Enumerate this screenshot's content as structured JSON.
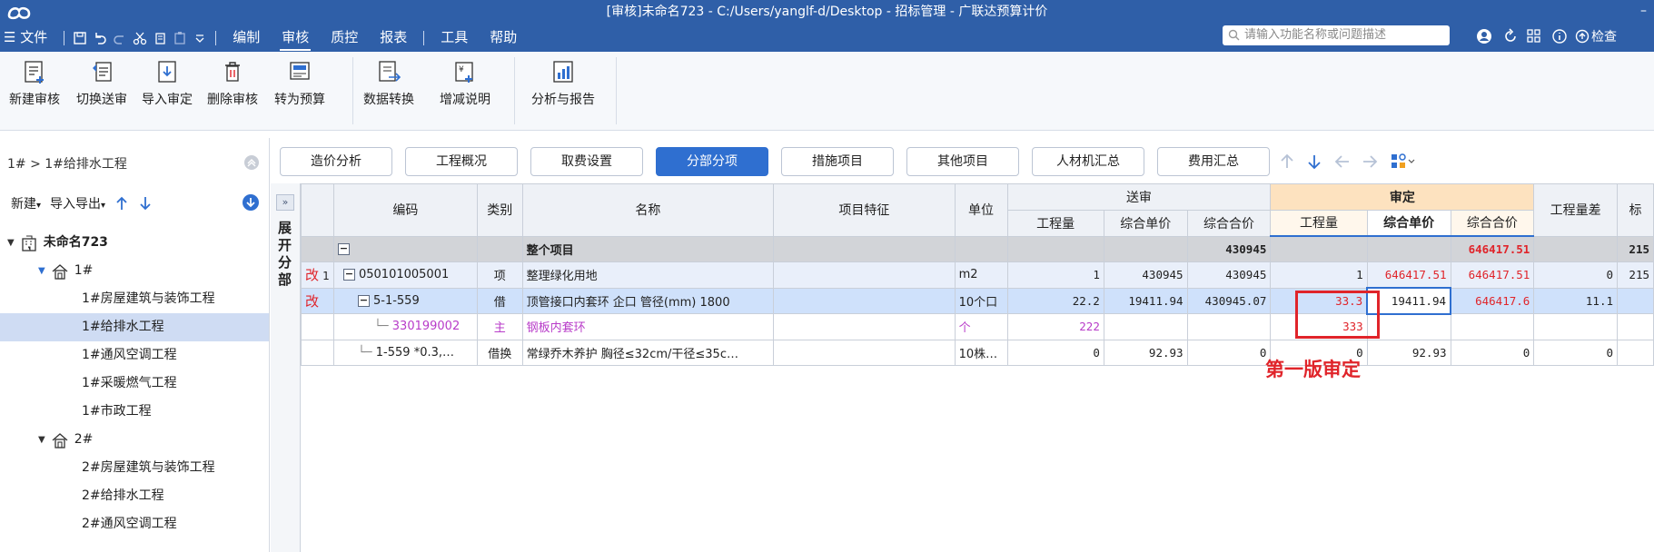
{
  "window": {
    "title": "[审核]未命名723 - C:/Users/yanglf-d/Desktop - 招标管理 - 广联达预算计价",
    "minimize_label": "–"
  },
  "menu": {
    "file": "☰ 文件",
    "items": [
      "编制",
      "审核",
      "质控",
      "报表",
      "工具",
      "帮助"
    ]
  },
  "search": {
    "placeholder": "请输入功能名称或问题描述"
  },
  "right_tools": {
    "check_label": "检查"
  },
  "ribbon": {
    "buttons": [
      "新建审核",
      "切换送审",
      "导入审定",
      "删除审核",
      "转为预算",
      "数据转换",
      "增减说明",
      "分析与报告"
    ]
  },
  "left": {
    "breadcrumb": "1# > 1#给排水工程",
    "toolbar": {
      "new_label": "新建",
      "import_export_label": "导入导出"
    },
    "tree": {
      "root": "未命名723",
      "group1": "1#",
      "g1_items": [
        "1#房屋建筑与装饰工程",
        "1#给排水工程",
        "1#通风空调工程",
        "1#采暖燃气工程",
        "1#市政工程"
      ],
      "group2": "2#",
      "g2_items": [
        "2#房屋建筑与装饰工程",
        "2#给排水工程",
        "2#通风空调工程"
      ]
    }
  },
  "tabs": [
    "造价分析",
    "工程概况",
    "取费设置",
    "分部分项",
    "措施项目",
    "其他项目",
    "人材机汇总",
    "费用汇总"
  ],
  "grid": {
    "expand_label": "展开分部",
    "headers": {
      "code": "编码",
      "type": "类别",
      "name": "名称",
      "feature": "项目特征",
      "unit": "单位",
      "submitted": "送审",
      "approved": "审定",
      "qty": "工程量",
      "unit_price": "综合单价",
      "total": "综合合价",
      "qty_diff": "工程量差",
      "cut": "标"
    },
    "rows": [
      {
        "mark": "",
        "no": "",
        "code": "",
        "type": "",
        "name": "整个项目",
        "feature": "",
        "unit": "",
        "s_qty": "",
        "s_price": "",
        "s_total": "430945",
        "a_qty": "",
        "a_price": "",
        "a_total": "646417.51",
        "diff": "",
        "cut": "215"
      },
      {
        "mark": "改",
        "no": "1",
        "code": "050101005001",
        "type": "项",
        "name": "整理绿化用地",
        "feature": "",
        "unit": "m2",
        "s_qty": "1",
        "s_price": "430945",
        "s_total": "430945",
        "a_qty": "1",
        "a_price": "646417.51",
        "a_total": "646417.51",
        "diff": "0",
        "cut": "215"
      },
      {
        "mark": "改",
        "no": "",
        "code": "5-1-559",
        "type": "借",
        "name": "顶管接口内套环 企口 管径(mm) 1800",
        "feature": "",
        "unit": "10个口",
        "s_qty": "22.2",
        "s_price": "19411.94",
        "s_total": "430945.07",
        "a_qty": "33.3",
        "a_price": "19411.94",
        "a_total": "646417.6",
        "diff": "11.1",
        "cut": ""
      },
      {
        "mark": "",
        "no": "",
        "code": "330199002",
        "type": "主",
        "name": "钢板内套环",
        "feature": "",
        "unit": "个",
        "s_qty": "222",
        "s_price": "",
        "s_total": "",
        "a_qty": "333",
        "a_price": "",
        "a_total": "",
        "diff": "",
        "cut": ""
      },
      {
        "mark": "",
        "no": "",
        "code": "1-559 *0.3,…",
        "type": "借换",
        "name": "常绿乔木养护 胸径≤32cm/干径≤35c…",
        "feature": "",
        "unit": "10株…",
        "s_qty": "0",
        "s_price": "92.93",
        "s_total": "0",
        "a_qty": "0",
        "a_price": "92.93",
        "a_total": "0",
        "diff": "0",
        "cut": ""
      }
    ]
  },
  "annotation": "第一版审定",
  "colors": {
    "title_bar": "#2f5fa8",
    "active_tab": "#2f6fd0",
    "approved_header": "#fde2bf",
    "annotation_red": "#e0242a",
    "selected_row": "#cfe1fb"
  }
}
